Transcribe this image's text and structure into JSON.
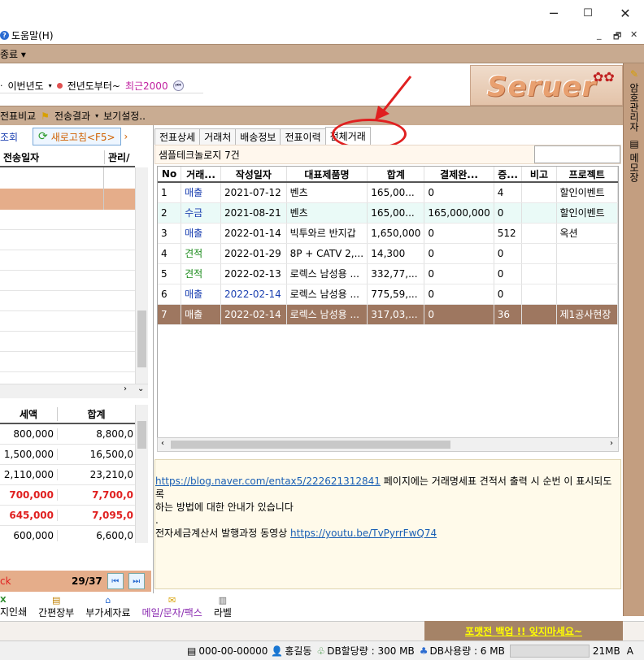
{
  "window": {
    "minimize": "─",
    "maximize": "☐",
    "close": "✕"
  },
  "menu": {
    "help_label": "도움말(H)",
    "mdi_min": "_",
    "mdi_restore": "🗗",
    "mdi_close": "✕"
  },
  "menubar2": {
    "exit_label": "종료 ▾"
  },
  "toolbar": {
    "this_year": "이번년도",
    "prev_year": "전년도부터~",
    "recent": "최근2000"
  },
  "logo": {
    "text": "Seruer"
  },
  "actions": {
    "compare": "전표비교",
    "send_result": "전송결과",
    "view_settings": "보기설정.."
  },
  "right_sidebar": {
    "tab1": "암호관리자",
    "tab2": "메모장"
  },
  "left": {
    "query_label": "조회",
    "refresh_label": "새로고침<F5>",
    "col_senddate": "전송일자",
    "col_manage": "관리/",
    "sum_cols": {
      "tax": "세액",
      "total": "합계"
    },
    "sum_rows": [
      {
        "tax": "800,000",
        "total": "8,800,0",
        "red": false
      },
      {
        "tax": "1,500,000",
        "total": "16,500,0",
        "red": false
      },
      {
        "tax": "2,110,000",
        "total": "23,210,0",
        "red": false
      },
      {
        "tax": "700,000",
        "total": "7,700,0",
        "red": true
      },
      {
        "tax": "645,000",
        "total": "7,095,0",
        "red": true
      },
      {
        "tax": "600,000",
        "total": "6,600,0",
        "red": false
      }
    ],
    "footer_left": "ck",
    "pager": "29/37"
  },
  "tabs": [
    "전표상세",
    "거래처",
    "배송정보",
    "전표이력",
    "전체거래"
  ],
  "client_line": "샘플테크놀로지 7건",
  "grid": {
    "headers": [
      "No",
      "거래...",
      "작성일자",
      "대표제품명",
      "합계",
      "결제완...",
      "증...",
      "비고",
      "프로젝트"
    ],
    "rows": [
      {
        "no": "1",
        "type": "매출",
        "date": "2021-07-12",
        "product": "벤츠",
        "total": "165,00...",
        "paid": "0",
        "cnt": "4",
        "note": "",
        "project": "할인이벤트",
        "tcolor": "#1a3fb0",
        "dcolor": "#000"
      },
      {
        "no": "2",
        "type": "수금",
        "date": "2021-08-21",
        "product": "벤츠",
        "total": "165,00...",
        "paid": "165,000,000",
        "cnt": "0",
        "note": "",
        "project": "할인이벤트",
        "tcolor": "#1a3fb0",
        "dcolor": "#000"
      },
      {
        "no": "3",
        "type": "매출",
        "date": "2022-01-14",
        "product": "빅투와르 반지갑",
        "total": "1,650,000",
        "paid": "0",
        "cnt": "512",
        "note": "",
        "project": "옥션",
        "tcolor": "#1a3fb0",
        "dcolor": "#000"
      },
      {
        "no": "4",
        "type": "견적",
        "date": "2022-01-29",
        "product": "8P + CATV 2,...",
        "total": "14,300",
        "paid": "0",
        "cnt": "0",
        "note": "",
        "project": "",
        "tcolor": "#1a8a1a",
        "dcolor": "#000"
      },
      {
        "no": "5",
        "type": "견적",
        "date": "2022-02-13",
        "product": "로렉스 남성용 ...",
        "total": "332,77,...",
        "paid": "0",
        "cnt": "0",
        "note": "",
        "project": "",
        "tcolor": "#1a8a1a",
        "dcolor": "#000"
      },
      {
        "no": "6",
        "type": "매출",
        "date": "2022-02-14",
        "product": "로렉스 남성용 ...",
        "total": "775,59,...",
        "paid": "0",
        "cnt": "0",
        "note": "",
        "project": "",
        "tcolor": "#1a3fb0",
        "dcolor": "#1a3fb0"
      },
      {
        "no": "7",
        "type": "매출",
        "date": "2022-02-14",
        "product": "로렉스 남성용 ...",
        "total": "317,03,...",
        "paid": "0",
        "cnt": "36",
        "note": "",
        "project": "제1공사현장",
        "tcolor": "#fff",
        "dcolor": "#fff"
      }
    ]
  },
  "info": {
    "link1": "https://blog.naver.com/entax5/222621312841",
    "text1": " 페이지에는 거래명세표 견적서 출력 시 순번 이 표시되도록",
    "text2": "하는 방법에 대한 안내가 있습니다",
    "dot": ".",
    "text3": "전자세금계산서 발행과정 동영상 ",
    "link2": "https://youtu.be/TvPyrrFwQ74"
  },
  "bottom": {
    "print": "지인쇄",
    "ledger": "간편장부",
    "vat": "부가세자료",
    "mail": "메일/문자/팩스",
    "label": "라벨"
  },
  "backup": "포맷전 백업 !! 잊지마세요~",
  "status": {
    "code": "000-00-00000",
    "user": "홍길동",
    "db_alloc": "DB할당량 : 300 MB",
    "db_use": "DB사용량 : 6 MB",
    "mem": "21MB",
    "mode": "A"
  },
  "colors": {
    "brown": "#9e7760",
    "accent_red": "#e02020",
    "blue_text": "#1a3fb0",
    "green_text": "#1a8a1a"
  }
}
